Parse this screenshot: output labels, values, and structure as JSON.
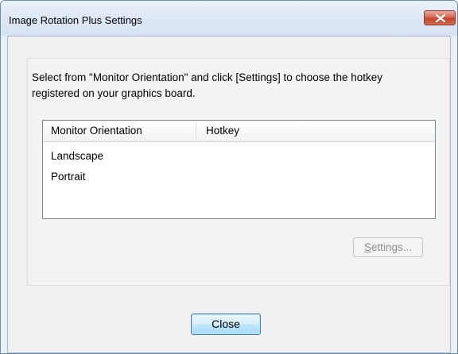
{
  "window": {
    "title": "Image Rotation Plus Settings",
    "close_icon": "close-x-icon"
  },
  "instructions": "Select from \"Monitor Orientation\" and click [Settings] to choose the hotkey registered on your graphics board.",
  "list": {
    "columns": [
      "Monitor Orientation",
      "Hotkey"
    ],
    "rows": [
      {
        "orientation": "Landscape",
        "hotkey": ""
      },
      {
        "orientation": "Portrait",
        "hotkey": ""
      }
    ]
  },
  "buttons": {
    "settings_prefix": "",
    "settings_underlined": "S",
    "settings_rest": "ettings...",
    "settings_enabled": false,
    "close": "Close"
  },
  "colors": {
    "close_button_red": "#c3442b",
    "focus_button_blue": "#3c7fb1",
    "disabled_text": "#8d8d8d"
  }
}
